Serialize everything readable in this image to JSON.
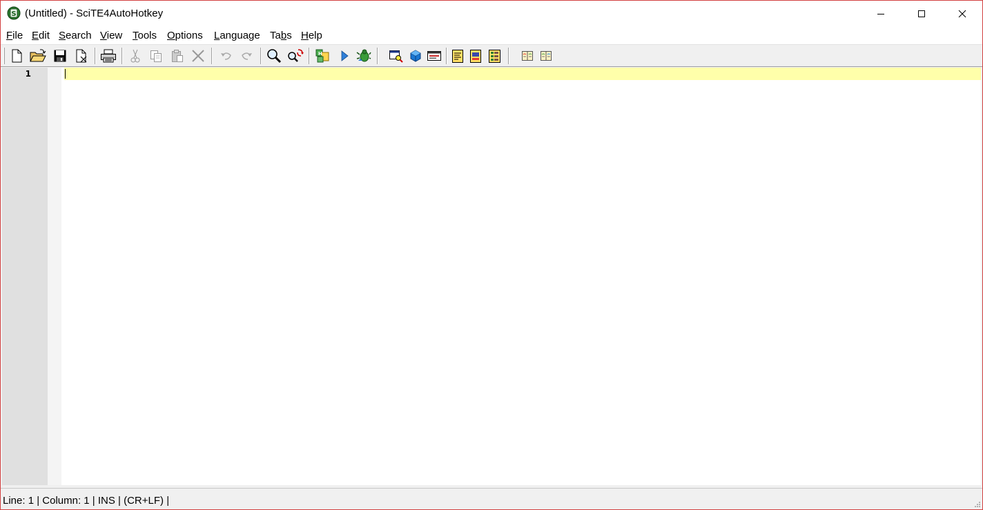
{
  "window": {
    "title": "(Untitled) - SciTE4AutoHotkey"
  },
  "menu": [
    {
      "label": "File",
      "mnemonic": "F",
      "rest": "ile"
    },
    {
      "label": "Edit",
      "mnemonic": "E",
      "rest": "dit"
    },
    {
      "label": "Search",
      "mnemonic": "S",
      "rest": "earch"
    },
    {
      "label": "View",
      "mnemonic": "V",
      "rest": "iew"
    },
    {
      "label": "Tools",
      "mnemonic": "T",
      "rest": "ools"
    },
    {
      "label": "Options",
      "mnemonic": "O",
      "rest": "ptions"
    },
    {
      "label": "Language",
      "mnemonic": "L",
      "rest": "anguage"
    },
    {
      "label": "Tabs",
      "pre": "Ta",
      "mnemonic": "b",
      "rest": "s"
    },
    {
      "label": "Help",
      "mnemonic": "H",
      "rest": "elp"
    }
  ],
  "toolbar": {
    "buttons": [
      {
        "icon": "new-file-icon",
        "enabled": true
      },
      {
        "icon": "open-folder-icon",
        "enabled": true
      },
      {
        "icon": "save-icon",
        "enabled": true
      },
      {
        "icon": "close-file-icon",
        "enabled": true
      },
      {
        "icon": "print-icon",
        "enabled": true
      },
      {
        "icon": "cut-icon",
        "enabled": false
      },
      {
        "icon": "copy-icon",
        "enabled": false
      },
      {
        "icon": "paste-icon",
        "enabled": false
      },
      {
        "icon": "delete-icon",
        "enabled": false
      },
      {
        "icon": "undo-icon",
        "enabled": false
      },
      {
        "icon": "redo-icon",
        "enabled": false
      },
      {
        "icon": "find-icon",
        "enabled": true
      },
      {
        "icon": "replace-icon",
        "enabled": true
      },
      {
        "icon": "compile-icon",
        "enabled": true
      },
      {
        "icon": "run-icon",
        "enabled": true
      },
      {
        "icon": "debug-icon",
        "enabled": true
      },
      {
        "icon": "window-spy-icon",
        "enabled": true
      },
      {
        "icon": "object-browser-icon",
        "enabled": true
      },
      {
        "icon": "gui-window-icon",
        "enabled": true
      },
      {
        "icon": "notes-icon",
        "enabled": true
      },
      {
        "icon": "find-notes-icon",
        "enabled": true
      },
      {
        "icon": "list-notes-icon",
        "enabled": true
      },
      {
        "icon": "help-book-icon",
        "enabled": true
      },
      {
        "icon": "reference-book-icon",
        "enabled": true
      }
    ]
  },
  "editor": {
    "line_numbers": [
      "1"
    ],
    "caret_line_color": "#ffffaa",
    "margin_color": "#e0e0e0"
  },
  "statusbar": {
    "text": "Line: 1 | Column: 1 | INS | (CR+LF) |"
  }
}
